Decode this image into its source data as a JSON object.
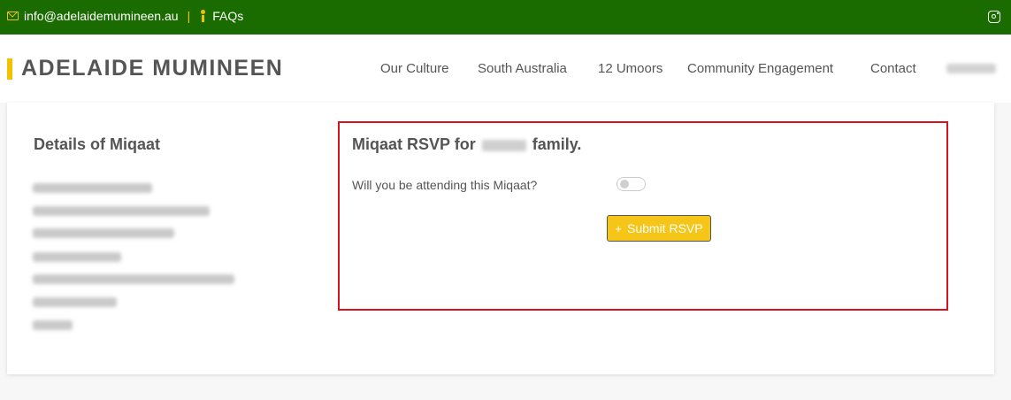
{
  "topbar": {
    "email": "info@adelaidemumineen.au",
    "separator": "|",
    "faqs": "FAQs",
    "icons": {
      "email": "envelope-icon",
      "faqs": "person-icon",
      "social": "instagram-icon"
    }
  },
  "header": {
    "logo": "ADELAIDE MUMINEEN",
    "nav": [
      "Our Culture",
      "South Australia",
      "12 Umoors",
      "Community Engagement",
      "Contact"
    ]
  },
  "details": {
    "title": "Details of Miqaat"
  },
  "rsvp": {
    "title_prefix": "Miqaat RSVP for",
    "title_suffix": "family.",
    "question": "Will you be attending this Miqaat?",
    "attending": false,
    "submit_label": "Submit RSVP",
    "submit_icon": "+"
  },
  "colors": {
    "topbar": "#1a6b00",
    "accent": "#f2c200",
    "button": "#f5c518",
    "highlight_border": "#d6141e"
  }
}
